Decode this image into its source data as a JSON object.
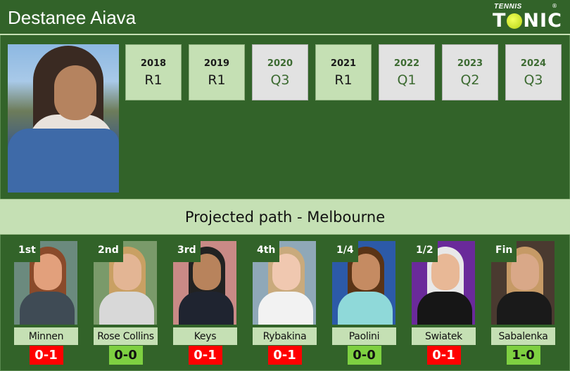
{
  "header": {
    "player_name": "Destanee Aiava",
    "logo": {
      "top": "TENNIS",
      "left": "T",
      "right": "NIC",
      "mark": "®"
    }
  },
  "history": [
    {
      "year": "2018",
      "result": "R1",
      "type": "main"
    },
    {
      "year": "2019",
      "result": "R1",
      "type": "main"
    },
    {
      "year": "2020",
      "result": "Q3",
      "type": "qualifying"
    },
    {
      "year": "2021",
      "result": "R1",
      "type": "main"
    },
    {
      "year": "2022",
      "result": "Q1",
      "type": "qualifying"
    },
    {
      "year": "2023",
      "result": "Q2",
      "type": "qualifying"
    },
    {
      "year": "2024",
      "result": "Q3",
      "type": "qualifying"
    }
  ],
  "section_title": "Projected path - Melbourne",
  "path": [
    {
      "round": "1st",
      "opponent": "Minnen",
      "h2h": "0-1",
      "status": "loss",
      "colors": {
        "bg": "#6b8a7e",
        "skin": "#e2a07c",
        "hair": "#8a4a2a",
        "body": "#3f4b55"
      }
    },
    {
      "round": "2nd",
      "opponent": "Rose Collins",
      "h2h": "0-0",
      "status": "even",
      "colors": {
        "bg": "#7a9a6a",
        "skin": "#e3b594",
        "hair": "#c9a063",
        "body": "#d8d8d8"
      }
    },
    {
      "round": "3rd",
      "opponent": "Keys",
      "h2h": "0-1",
      "status": "loss",
      "colors": {
        "bg": "#c98a86",
        "skin": "#b8835c",
        "hair": "#222222",
        "body": "#1f2430"
      }
    },
    {
      "round": "4th",
      "opponent": "Rybakina",
      "h2h": "0-1",
      "status": "loss",
      "colors": {
        "bg": "#8fa8b8",
        "skin": "#f0c8b0",
        "hair": "#c9aa7c",
        "body": "#f2f2f2"
      }
    },
    {
      "round": "1/4",
      "opponent": "Paolini",
      "h2h": "0-0",
      "status": "even",
      "colors": {
        "bg": "#2c5aa8",
        "skin": "#c58b62",
        "hair": "#5a3416",
        "body": "#8fd9d9"
      }
    },
    {
      "round": "1/2",
      "opponent": "Swiatek",
      "h2h": "0-1",
      "status": "loss",
      "colors": {
        "bg": "#6a2a9a",
        "skin": "#e8b896",
        "hair": "#e8e8e8",
        "body": "#161616"
      }
    },
    {
      "round": "Fin",
      "opponent": "Sabalenka",
      "h2h": "1-0",
      "status": "even",
      "colors": {
        "bg": "#4a3a30",
        "skin": "#d9a888",
        "hair": "#c69a66",
        "body": "#1a1a1a"
      }
    }
  ],
  "colors": {
    "background": "#326329",
    "light_green": "#c5e0b4",
    "qualifying_box": "#e2e2e2",
    "loss": "#ff0000",
    "even_or_win": "#7ed041"
  }
}
